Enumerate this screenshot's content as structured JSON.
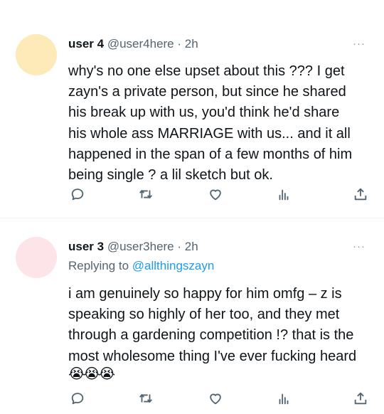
{
  "tweets": [
    {
      "username": "user 4",
      "handle": "@user4here",
      "sep": " · ",
      "time": "2h",
      "more": "···",
      "avatar_color": "#fdeab8",
      "text": "why's no one else upset about this ??? I get\nzayn's a private person, but since he shared\nhis break up with us, you'd think he'd share\nhis whole ass MARRIAGE with us... and it all\nhappened in the span of a few months of him\nbeing single ? a lil sketch but ok.",
      "actions": [
        "reply-icon",
        "retweet-icon",
        "like-icon",
        "views-icon",
        "share-icon"
      ]
    },
    {
      "username": "user 3",
      "handle": "@user3here",
      "sep": " · ",
      "time": "2h",
      "more": "···",
      "avatar_color": "#fde4e9",
      "replying_prefix": "Replying to ",
      "replying_to": "@allthingszayn",
      "text": "i am genuinely so happy for him omfg – z is\nspeaking so highly of her too, and they met\nthrough a gardening competition !? that is the\nmost wholesome thing I've ever fucking heard",
      "emoji": "😭😭😭",
      "actions": [
        "reply-icon",
        "retweet-icon",
        "like-icon",
        "views-icon",
        "share-icon"
      ]
    }
  ],
  "colors": {
    "text": "#0f1419",
    "secondary": "#536471",
    "link": "#1d9bf0",
    "divider": "#eff3f4"
  }
}
